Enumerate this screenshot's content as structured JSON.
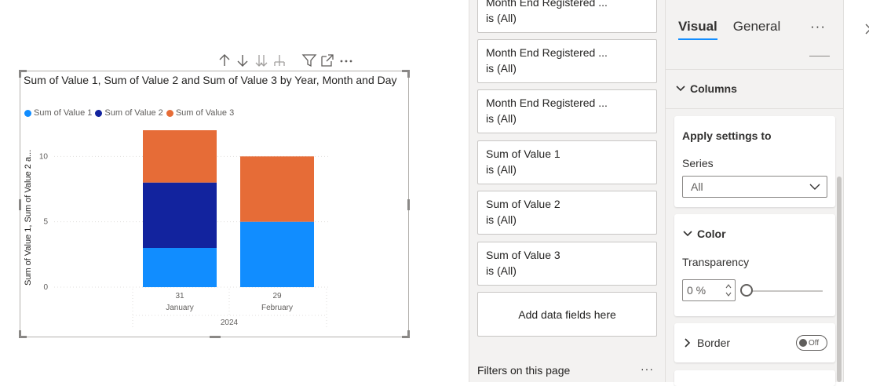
{
  "visual": {
    "title": "Sum of Value 1, Sum of Value 2 and Sum of Value 3 by Year, Month and Day",
    "toolbar_icons": [
      "arrow-up-icon",
      "arrow-down-icon",
      "double-arrow-down-icon",
      "expand-hierarchy-icon",
      "filter-icon",
      "focus-mode-icon",
      "more-options-icon"
    ],
    "more_label": "···"
  },
  "chart_data": {
    "type": "bar",
    "stacked": true,
    "title": "Sum of Value 1, Sum of Value 2 and Sum of Value 3 by Year, Month and Day",
    "ylabel": "Sum of Value 1, Sum of Value 2 a...",
    "xlabel": "",
    "ylim": [
      0,
      12
    ],
    "yticks": [
      0,
      5,
      10
    ],
    "categories": [
      {
        "day": "31",
        "month": "January",
        "year": "2024"
      },
      {
        "day": "29",
        "month": "February",
        "year": "2024"
      }
    ],
    "year_label": "2024",
    "series": [
      {
        "name": "Sum of Value 1",
        "color": "#118dff",
        "values": [
          3,
          5
        ]
      },
      {
        "name": "Sum of Value 2",
        "color": "#12239e",
        "values": [
          5,
          0
        ]
      },
      {
        "name": "Sum of Value 3",
        "color": "#e66c37",
        "values": [
          4,
          5
        ]
      }
    ],
    "legend_position": "top-left",
    "grid": true
  },
  "filters": {
    "cards": [
      {
        "name": "Month End Registered ...",
        "state": "is (All)"
      },
      {
        "name": "Month End Registered ...",
        "state": "is (All)"
      },
      {
        "name": "Month End Registered ...",
        "state": "is (All)"
      },
      {
        "name": "Sum of Value 1",
        "state": "is (All)"
      },
      {
        "name": "Sum of Value 2",
        "state": "is (All)"
      },
      {
        "name": "Sum of Value 3",
        "state": "is (All)"
      }
    ],
    "add_fields": "Add data fields here",
    "page_section": "Filters on this page",
    "more": "···"
  },
  "format": {
    "tabs": [
      "Visual",
      "General"
    ],
    "active_tab": "Visual",
    "more": "···",
    "columns_section": "Columns",
    "apply_settings": "Apply settings to",
    "series_label": "Series",
    "series_value": "All",
    "color_section": "Color",
    "transparency_label": "Transparency",
    "transparency_value": "0 %",
    "transparency_level": 0,
    "border_section": "Border",
    "border_toggle": "Off"
  }
}
